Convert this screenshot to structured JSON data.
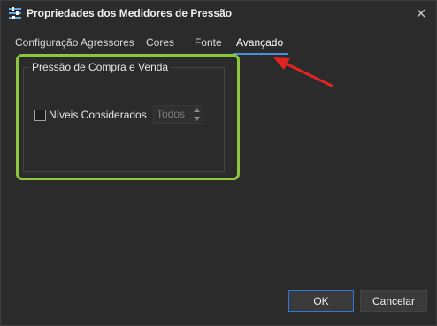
{
  "window": {
    "title": "Propriedades dos Medidores de Pressão",
    "icon": "sliders-icon",
    "close_icon": "close-icon"
  },
  "tabs": [
    {
      "label": "Configuração Agressores",
      "active": false
    },
    {
      "label": "Cores",
      "active": false
    },
    {
      "label": "Fonte",
      "active": false
    },
    {
      "label": "Avançado",
      "active": true
    }
  ],
  "group": {
    "title": "Pressão de Compra e Venda",
    "checkbox_label": "Níveis Considerados",
    "checkbox_checked": false,
    "spin_value": "Todos"
  },
  "buttons": {
    "ok": "OK",
    "cancel": "Cancelar"
  },
  "colors": {
    "background": "#2b2b2b",
    "highlight_box": "#8ac93b",
    "annotation_arrow": "#e02424",
    "tab_accent": "#4a90d9",
    "ok_border": "#2d7ad6"
  }
}
